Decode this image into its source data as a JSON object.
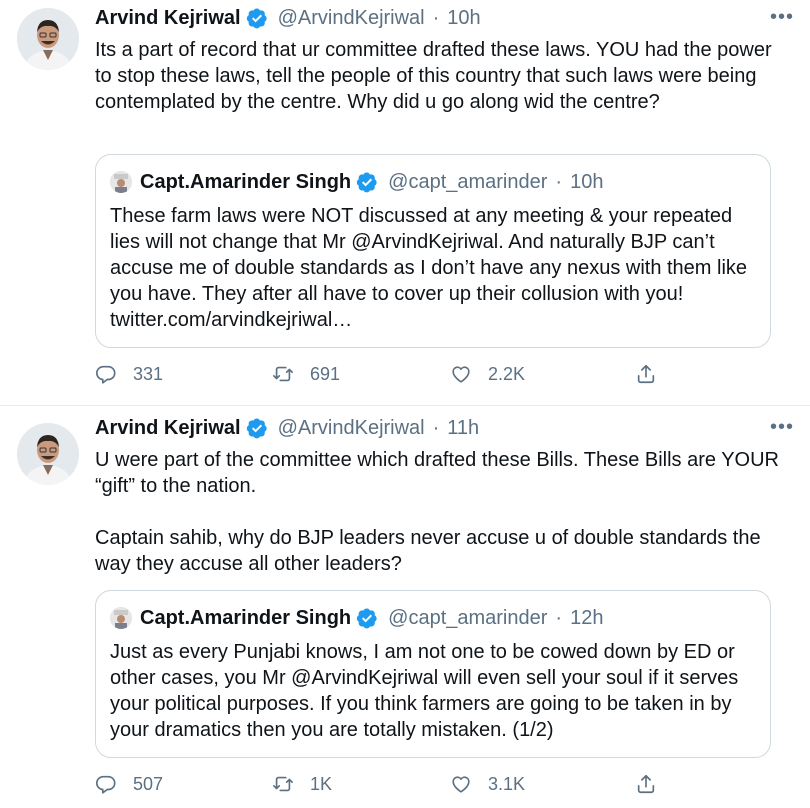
{
  "tweets": [
    {
      "author": {
        "name": "Arvind Kejriwal",
        "handle": "@ArvindKejriwal"
      },
      "time": "10h",
      "more": "•••",
      "text": "Its a part of record that ur committee drafted these laws. YOU had the power to stop these laws, tell the people of this country that such laws were being contemplated by the centre. Why did u go along wid the centre?",
      "quote": {
        "author": {
          "name": "Capt.Amarinder Singh",
          "handle": "@capt_amarinder"
        },
        "time": "10h",
        "text": "These farm laws were NOT discussed at any meeting & your repeated lies will not change that Mr @ArvindKejriwal. And naturally BJP can’t accuse me of double standards as I don’t have any nexus with them like you have. They after all have to cover up their collusion with you! twitter.com/arvindkejriwal…"
      },
      "stats": {
        "replies": "331",
        "retweets": "691",
        "likes": "2.2K"
      }
    },
    {
      "author": {
        "name": "Arvind Kejriwal",
        "handle": "@ArvindKejriwal"
      },
      "time": "11h",
      "more": "•••",
      "text": "U were part of the committee which drafted these Bills. These Bills are YOUR “gift” to the nation.\n\nCaptain sahib, why do BJP leaders never accuse u of double standards the way they accuse all other leaders?",
      "quote": {
        "author": {
          "name": "Capt.Amarinder Singh",
          "handle": "@capt_amarinder"
        },
        "time": "12h",
        "text": "Just as every Punjabi knows, I am not one to be cowed down by ED or other cases, you Mr @ArvindKejriwal will even sell your soul if it serves your political purposes. If you think farmers are going to be taken in by your dramatics then you are totally mistaken. (1/2)"
      },
      "stats": {
        "replies": "507",
        "retweets": "1K",
        "likes": "3.1K"
      }
    }
  ],
  "separator": "·",
  "icons": {
    "verified": "verified-badge-icon",
    "reply": "reply-icon",
    "retweet": "retweet-icon",
    "like": "heart-icon",
    "share": "share-icon",
    "more": "more-options-icon"
  },
  "colors": {
    "verified": "#1d9bf0",
    "muted": "#5b7083",
    "text": "#0f1419",
    "border": "#cfd9de"
  }
}
